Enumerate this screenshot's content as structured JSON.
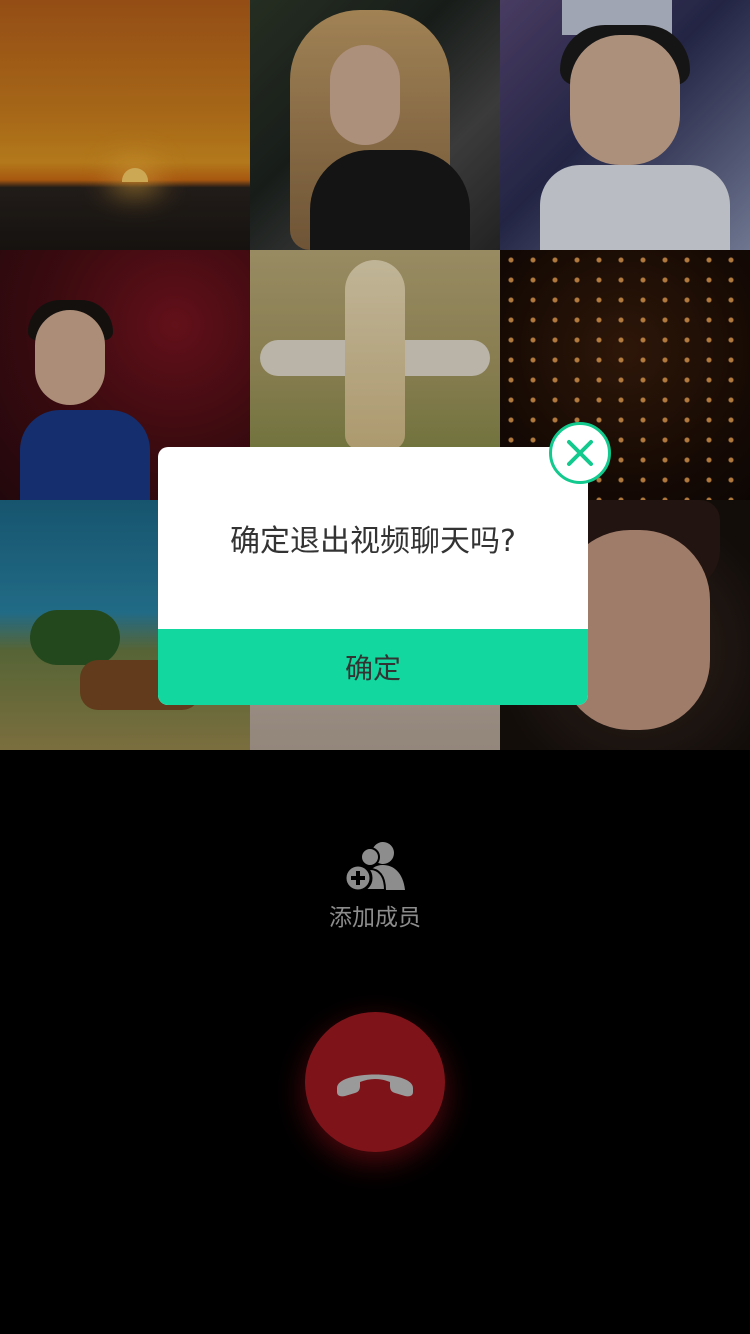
{
  "grid": {
    "tiles": [
      "sunset-sea",
      "woman-blonde",
      "man-crown",
      "man-roses",
      "girl-field",
      "sky-lanterns",
      "coast-cow",
      "person-white-dress",
      "girl-portrait"
    ]
  },
  "add_member": {
    "label": "添加成员",
    "icon": "add-members-icon"
  },
  "hangup": {
    "icon": "hangup-phone-icon"
  },
  "dialog": {
    "message": "确定退出视频聊天吗?",
    "confirm_label": "确定",
    "close_icon": "close-icon",
    "accent_color": "#12d89f"
  },
  "colors": {
    "hangup": "#7e141a",
    "background": "#000000"
  }
}
